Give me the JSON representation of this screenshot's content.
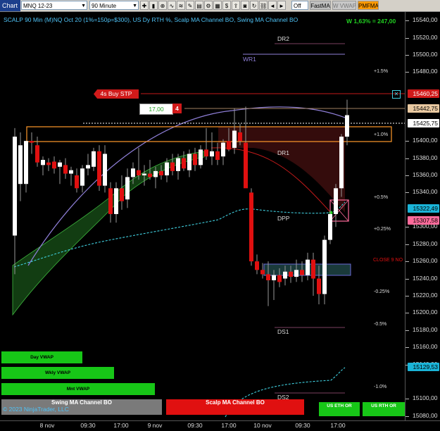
{
  "toolbar": {
    "chart_tab": "Chart",
    "instrument": "MNQ 12-23",
    "interval": "90 Minute",
    "off_label": "Off",
    "fastma_label": "FastMA",
    "wvwap_label": "W VWAP",
    "pmfma_label": "PMFMA"
  },
  "header": {
    "title": "SCALP 90 Min (M)NQ Oct 20 (1%=150p=$300), US Dy RTH %, Scalp MA Channel BO, Swing MA Channel BO",
    "result": "W 1,63% = 247,00"
  },
  "order": {
    "label": "4s  Buy STP",
    "qty": "17,00",
    "count": "4"
  },
  "levels": {
    "dr2": "DR2",
    "wr1": "WR1",
    "dr1": "DR1",
    "dpp": "DPP",
    "ds1": "DS1",
    "ds2": "DS2",
    "close": "CLOSE 9 NO"
  },
  "pct_labels": {
    "p15": "+1.5%",
    "p10": "+1.0%",
    "p05": "+0.5%",
    "p025": "+0.25%",
    "m025": "-0.25%",
    "m05": "-0.5%",
    "m10": "-1.0%"
  },
  "vwap_buttons": {
    "day": "Day VWAP",
    "wkly": "Wkly VWAP",
    "mnt": "Mnt VWAP"
  },
  "footer": {
    "swing": "Swing MA Channel BO",
    "copyright": "© 2023 NinjaTrader, LLC",
    "scalp": "Scalp MA Channel BO",
    "us_eth": "US ETH OR",
    "us_rth": "US RTH OR"
  },
  "y_axis": [
    "15540,00",
    "15520,00",
    "15500,00",
    "15480,00",
    "15400,00",
    "15380,00",
    "15360,00",
    "15340,00",
    "15300,00",
    "15280,00",
    "15260,00",
    "15240,00",
    "15220,00",
    "15200,00",
    "15180,00",
    "15160,00",
    "15140,00",
    "15100,00",
    "15080,00"
  ],
  "price_badges": {
    "order": "15460,25",
    "target": "15442,75",
    "last": "15425,75",
    "ma": "15322,49",
    "stop": "15307,58",
    "low": "15129,53"
  },
  "x_axis": [
    "8 nov",
    "09:30",
    "17:00",
    "9 nov",
    "09:30",
    "17:00",
    "10 nov",
    "09:30",
    "17:00"
  ],
  "colors": {
    "bull": "#ffffff",
    "bear": "#e01010",
    "channel": "#1f6e1f",
    "accent": "#4fc3f7",
    "order_red": "#d11a1a"
  },
  "chart_data": {
    "type": "candlestick",
    "ylim": [
      15075,
      15550
    ],
    "candles": [
      {
        "o": 15290,
        "h": 15415,
        "l": 15245,
        "c": 15405
      },
      {
        "o": 15350,
        "h": 15410,
        "l": 15330,
        "c": 15395
      },
      {
        "o": 15350,
        "h": 15400,
        "l": 15340,
        "c": 15400
      },
      {
        "o": 15400,
        "h": 15410,
        "l": 15385,
        "c": 15398
      },
      {
        "o": 15395,
        "h": 15405,
        "l": 15370,
        "c": 15375
      },
      {
        "o": 15372,
        "h": 15382,
        "l": 15360,
        "c": 15378
      },
      {
        "o": 15375,
        "h": 15380,
        "l": 15365,
        "c": 15372
      },
      {
        "o": 15376,
        "h": 15382,
        "l": 15362,
        "c": 15368
      },
      {
        "o": 15370,
        "h": 15378,
        "l": 15350,
        "c": 15375
      },
      {
        "o": 15372,
        "h": 15380,
        "l": 15356,
        "c": 15362
      },
      {
        "o": 15362,
        "h": 15370,
        "l": 15348,
        "c": 15366
      },
      {
        "o": 15360,
        "h": 15368,
        "l": 15340,
        "c": 15345
      },
      {
        "o": 15348,
        "h": 15372,
        "l": 15340,
        "c": 15368
      },
      {
        "o": 15368,
        "h": 15385,
        "l": 15360,
        "c": 15372
      },
      {
        "o": 15370,
        "h": 15392,
        "l": 15365,
        "c": 15388
      },
      {
        "o": 15388,
        "h": 15395,
        "l": 15342,
        "c": 15348
      },
      {
        "o": 15348,
        "h": 15395,
        "l": 15340,
        "c": 15385
      },
      {
        "o": 15345,
        "h": 15352,
        "l": 15305,
        "c": 15315
      },
      {
        "o": 15315,
        "h": 15352,
        "l": 15305,
        "c": 15345
      },
      {
        "o": 15345,
        "h": 15360,
        "l": 15320,
        "c": 15330
      },
      {
        "o": 15332,
        "h": 15368,
        "l": 15322,
        "c": 15358
      },
      {
        "o": 15358,
        "h": 15375,
        "l": 15350,
        "c": 15368
      },
      {
        "o": 15366,
        "h": 15392,
        "l": 15355,
        "c": 15360
      },
      {
        "o": 15360,
        "h": 15372,
        "l": 15348,
        "c": 15362
      },
      {
        "o": 15362,
        "h": 15378,
        "l": 15355,
        "c": 15358
      },
      {
        "o": 15358,
        "h": 15370,
        "l": 15345,
        "c": 15365
      },
      {
        "o": 15365,
        "h": 15372,
        "l": 15355,
        "c": 15360
      },
      {
        "o": 15360,
        "h": 15380,
        "l": 15352,
        "c": 15375
      },
      {
        "o": 15375,
        "h": 15385,
        "l": 15360,
        "c": 15365
      },
      {
        "o": 15365,
        "h": 15385,
        "l": 15355,
        "c": 15380
      },
      {
        "o": 15380,
        "h": 15388,
        "l": 15365,
        "c": 15368
      },
      {
        "o": 15366,
        "h": 15390,
        "l": 15358,
        "c": 15385
      },
      {
        "o": 15385,
        "h": 15392,
        "l": 15365,
        "c": 15372
      },
      {
        "o": 15372,
        "h": 15395,
        "l": 15368,
        "c": 15390
      },
      {
        "o": 15390,
        "h": 15415,
        "l": 15378,
        "c": 15382
      },
      {
        "o": 15382,
        "h": 15410,
        "l": 15372,
        "c": 15388
      },
      {
        "o": 15388,
        "h": 15398,
        "l": 15372,
        "c": 15378
      },
      {
        "o": 15382,
        "h": 15402,
        "l": 15372,
        "c": 15398
      },
      {
        "o": 15400,
        "h": 15415,
        "l": 15388,
        "c": 15390
      },
      {
        "o": 15392,
        "h": 15438,
        "l": 15385,
        "c": 15412
      },
      {
        "o": 15410,
        "h": 15420,
        "l": 15395,
        "c": 15400
      },
      {
        "o": 15398,
        "h": 15440,
        "l": 15350,
        "c": 15345
      },
      {
        "o": 15340,
        "h": 15345,
        "l": 15255,
        "c": 15260
      },
      {
        "o": 15260,
        "h": 15268,
        "l": 15245,
        "c": 15250
      },
      {
        "o": 15250,
        "h": 15258,
        "l": 15240,
        "c": 15245
      },
      {
        "o": 15245,
        "h": 15260,
        "l": 15208,
        "c": 15238
      },
      {
        "o": 15238,
        "h": 15250,
        "l": 15215,
        "c": 15244
      },
      {
        "o": 15244,
        "h": 15252,
        "l": 15230,
        "c": 15236
      },
      {
        "o": 15240,
        "h": 15255,
        "l": 15232,
        "c": 15248
      },
      {
        "o": 15248,
        "h": 15255,
        "l": 15235,
        "c": 15242
      },
      {
        "o": 15242,
        "h": 15262,
        "l": 15236,
        "c": 15250
      },
      {
        "o": 15250,
        "h": 15260,
        "l": 15236,
        "c": 15244
      },
      {
        "o": 15244,
        "h": 15270,
        "l": 15238,
        "c": 15262
      },
      {
        "o": 15262,
        "h": 15270,
        "l": 15220,
        "c": 15240
      },
      {
        "o": 15240,
        "h": 15255,
        "l": 15210,
        "c": 15222
      },
      {
        "o": 15222,
        "h": 15290,
        "l": 15210,
        "c": 15285
      },
      {
        "o": 15285,
        "h": 15320,
        "l": 15280,
        "c": 15315
      },
      {
        "o": 15315,
        "h": 15350,
        "l": 15300,
        "c": 15345
      },
      {
        "o": 15345,
        "h": 15408,
        "l": 15335,
        "c": 15405
      },
      {
        "o": 15405,
        "h": 15448,
        "l": 15395,
        "c": 15430
      }
    ]
  }
}
